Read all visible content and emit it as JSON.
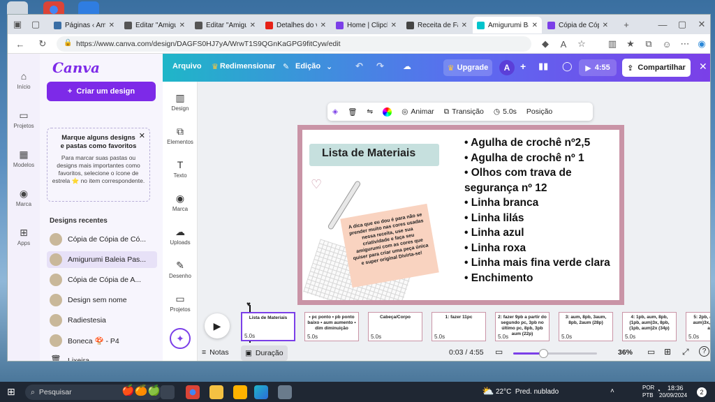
{
  "browser": {
    "tabs": [
      {
        "label": "Páginas ‹ Amigur",
        "color": "#3a6ea5"
      },
      {
        "label": "Editar \"Amigurumi",
        "color": "#555555"
      },
      {
        "label": "Editar \"Amigurumi",
        "color": "#555555"
      },
      {
        "label": "Detalhes do víde",
        "color": "#e62117"
      },
      {
        "label": "Home | Clipcham",
        "color": "#7b3fe8"
      },
      {
        "label": "Receita de Fantas",
        "color": "#444444"
      },
      {
        "label": "Amigurumi Balei",
        "color": "#00c4cc"
      },
      {
        "label": "Cópia de Cópia d",
        "color": "#7b3fe8"
      }
    ],
    "url": "https://www.canva.com/design/DAGFS0HJ7yA/WrwT1S9QGnKaGPG9fitCyw/edit"
  },
  "canva": {
    "logo": "Canva",
    "rail": [
      {
        "label": "Início",
        "icon": "home-icon"
      },
      {
        "label": "Projetos",
        "icon": "folder-icon"
      },
      {
        "label": "Modelos",
        "icon": "templates-icon"
      },
      {
        "label": "Marca",
        "icon": "brand-icon"
      },
      {
        "label": "Apps",
        "icon": "apps-icon"
      }
    ],
    "create_button": "Criar um design",
    "tip": {
      "title": "Marque alguns designs e pastas como favoritos",
      "body": "Para marcar suas pastas ou designs mais importantes como favoritos, selecione o ícone de estrela ⭐ no item correspondente."
    },
    "recent_title": "Designs recentes",
    "recent": [
      "Cópia de Cópia de Có...",
      "Amigurumi Baleia Pas...",
      "Cópia de Cópia de A...",
      "Design sem nome",
      "Radiestesia",
      "Boneca 🍄 - P4",
      "Lixeira"
    ],
    "topbar": {
      "arquivo": "Arquivo",
      "redimensionar": "Redimensionar",
      "edicao": "Edição",
      "upgrade": "Upgrade",
      "avatar": "A",
      "play_time": "4:55",
      "share": "Compartilhar"
    },
    "tools": [
      "Design",
      "Elementos",
      "Texto",
      "Marca",
      "Uploads",
      "Desenho",
      "Projetos"
    ],
    "context": {
      "animar": "Animar",
      "transicao": "Transição",
      "duracao": "5.0s",
      "posicao": "Posição"
    },
    "slide": {
      "title": "Lista de Materiais",
      "bullets": [
        "• Agulha de crochê nº2,5",
        "• Agulha de crochê nº 1",
        "• Olhos com trava de segurança nº 12",
        "• Linha branca",
        "• Linha lilás",
        "• Linha azul",
        "• Linha roxa",
        "• Linha mais fina verde clara",
        "• Enchimento"
      ],
      "note": "A dica que eu dou é para não se prender muito nas cores usadas nessa receita, use sua criatividade e faça seu amigurumi com as cores que quiser para criar uma peça única e super original Divirta-se!"
    },
    "timeline": {
      "thumbs": [
        {
          "text": "Lista de Materiais",
          "dur": "5.0s"
        },
        {
          "text": "• pc ponto • pb ponto baixo • aum aumento • dim diminuição",
          "dur": "5.0s"
        },
        {
          "text": "Cabeça/Corpo",
          "dur": "5.0s"
        },
        {
          "text": "1: fazer 11pc",
          "dur": "5.0s"
        },
        {
          "text": "2: fazer 9pb a partir do segundo pc, 3pb no último pc, 8pb, 3pb aum (22p)",
          "dur": "5.0s"
        },
        {
          "text": "3: aum, 8pb, 3aum, 8pb, 2aum (28p)",
          "dur": "5.0s"
        },
        {
          "text": "4: 1pb, aum, 8pb, (1pb, aum)3x, 8pb, (1pb, aum)2x (34p)",
          "dur": "5.0s"
        },
        {
          "text": "5: 2pb, aum, (2pb, aum)3x, 8pb, (2pb, aum)",
          "dur": "5.0s"
        }
      ]
    },
    "bottom": {
      "notes": "Notas",
      "duration": "Duração",
      "time": "0:03 / 4:55",
      "zoom": "36%",
      "zoom_level": 0.36
    }
  },
  "taskbar": {
    "search": "Pesquisar",
    "weather": "22°C  Pred. nublado",
    "lang1": "POR",
    "lang2": "PTB",
    "time": "18:36",
    "date": "20/09/2024",
    "notif": "2"
  }
}
